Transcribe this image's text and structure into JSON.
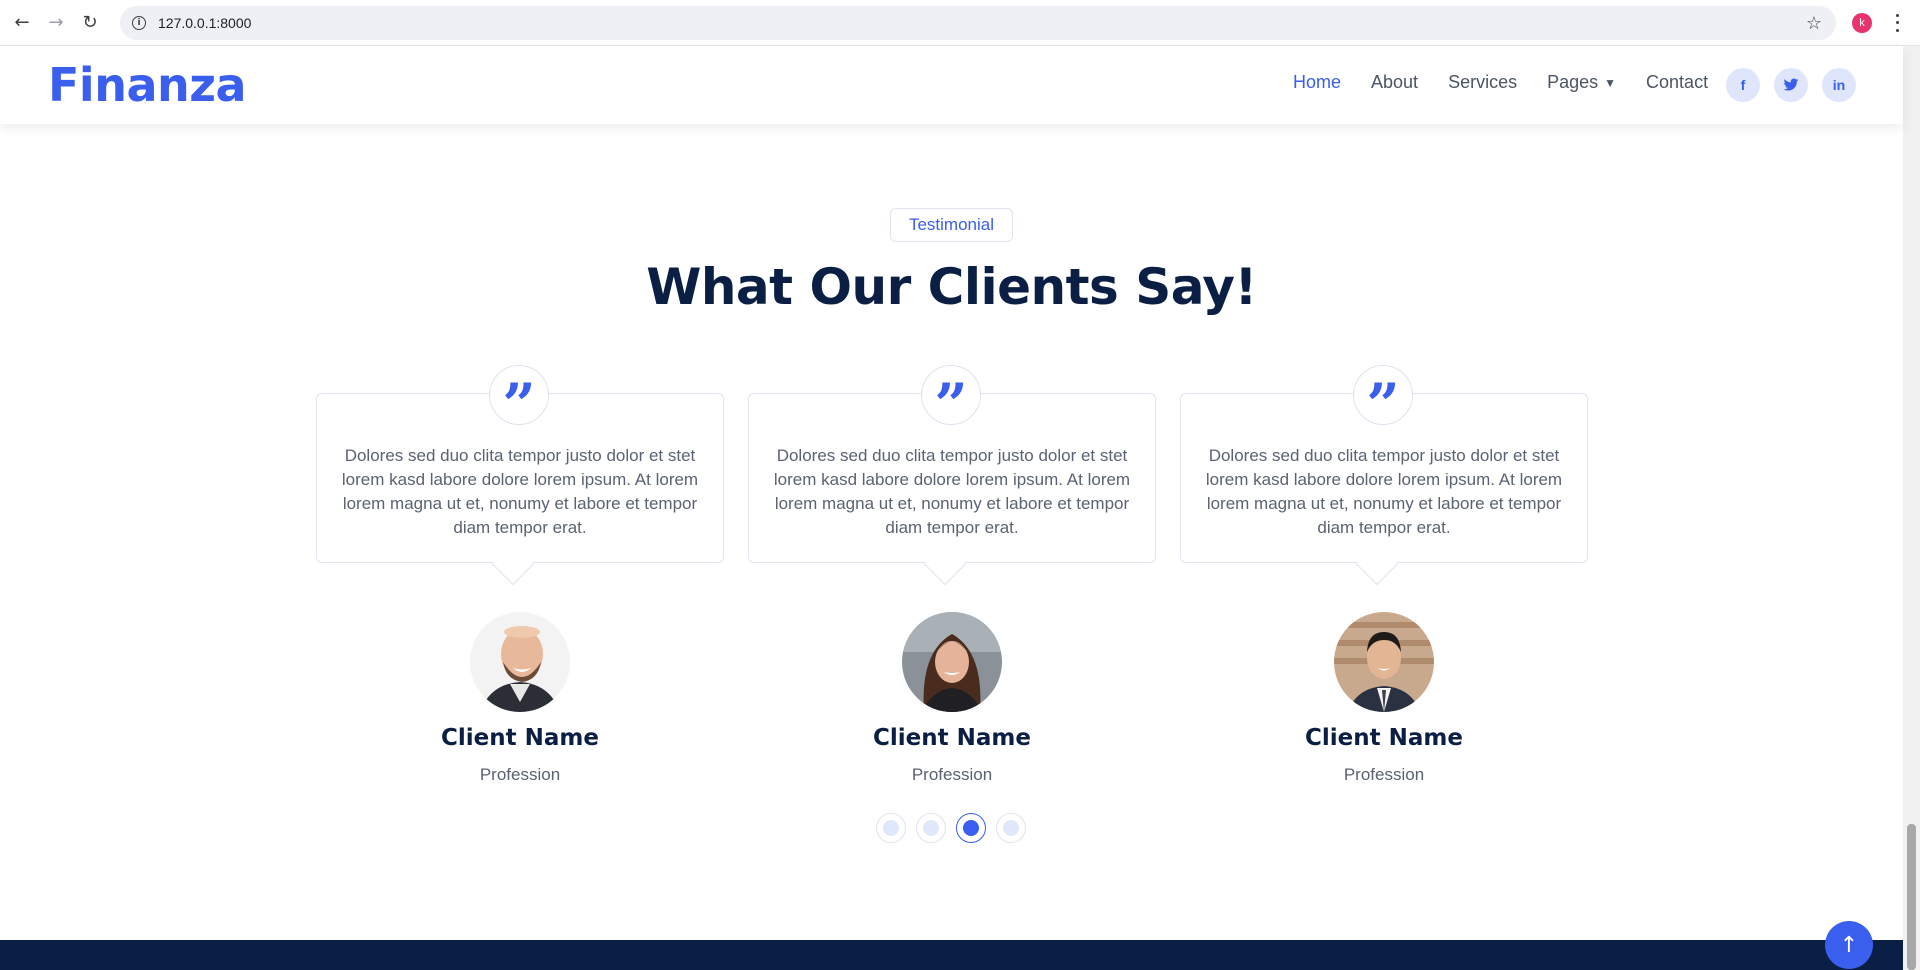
{
  "browser": {
    "url": "127.0.0.1:8000",
    "profile_initial": "k"
  },
  "navbar": {
    "logo": "Finanza",
    "menu": [
      {
        "label": "Home",
        "active": true
      },
      {
        "label": "About"
      },
      {
        "label": "Services"
      },
      {
        "label": "Pages",
        "dropdown": true
      },
      {
        "label": "Contact"
      }
    ],
    "social": [
      {
        "icon": "facebook-icon",
        "glyph": "f"
      },
      {
        "icon": "twitter-icon",
        "glyph": "t"
      },
      {
        "icon": "linkedin-icon",
        "glyph": "in"
      }
    ]
  },
  "testimonial": {
    "badge": "Testimonial",
    "title": "What Our Clients Say!",
    "cards": [
      {
        "text": "Dolores sed duo clita tempor justo dolor et stet lorem kasd labore dolore lorem ipsum. At lorem lorem magna ut et, nonumy et labore et tempor diam tempor erat.",
        "name": "Client Name",
        "profession": "Profession"
      },
      {
        "text": "Dolores sed duo clita tempor justo dolor et stet lorem kasd labore dolore lorem ipsum. At lorem lorem magna ut et, nonumy et labore et tempor diam tempor erat.",
        "name": "Client Name",
        "profession": "Profession"
      },
      {
        "text": "Dolores sed duo clita tempor justo dolor et stet lorem kasd labore dolore lorem ipsum. At lorem lorem magna ut et, nonumy et labore et tempor diam tempor erat.",
        "name": "Client Name",
        "profession": "Profession"
      }
    ],
    "carousel": {
      "total": 4,
      "active_index": 2
    }
  },
  "colors": {
    "brand": "#3a5eee",
    "dark": "#0b1f45",
    "muted": "#5a6372"
  }
}
